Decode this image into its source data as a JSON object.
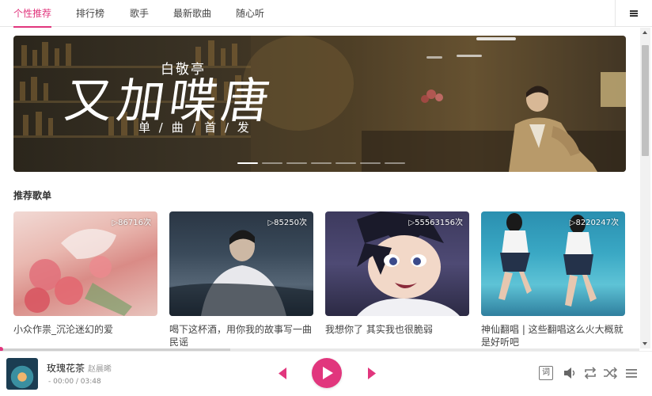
{
  "tabs": [
    {
      "label": "个性推荐",
      "active": true
    },
    {
      "label": "排行榜",
      "active": false
    },
    {
      "label": "歌手",
      "active": false
    },
    {
      "label": "最新歌曲",
      "active": false
    },
    {
      "label": "随心听",
      "active": false
    }
  ],
  "menu_icon": "hamburger-menu-icon",
  "banner": {
    "singer": "白敬亭",
    "title": "又加喋唐",
    "subtitle": "单 / 曲 / 首 / 发",
    "slides_total": 7,
    "active_slide": 1
  },
  "recommend": {
    "title": "推荐歌单",
    "playlists": [
      {
        "title": "小众作祟_沉沦迷幻的爱",
        "play_count": "▷86716次"
      },
      {
        "title": "喝下这杯酒，用你我的故事写一曲民谣",
        "play_count": "▷85250次"
      },
      {
        "title": "我想你了 其实我也很脆弱",
        "play_count": "▷55563156次"
      },
      {
        "title": "神仙翻唱 | 这些翻唱这么火大概就是好听吧",
        "play_count": "▷8220247次"
      }
    ]
  },
  "player": {
    "song": "玫瑰花茶",
    "artist": "赵晨晞",
    "time": "- 00:00 / 03:48",
    "progress": 0.0,
    "buffered": 0.36,
    "lyric_label": "词"
  },
  "colors": {
    "accent": "#e1367d",
    "text": "#333333",
    "muted": "#999999"
  }
}
